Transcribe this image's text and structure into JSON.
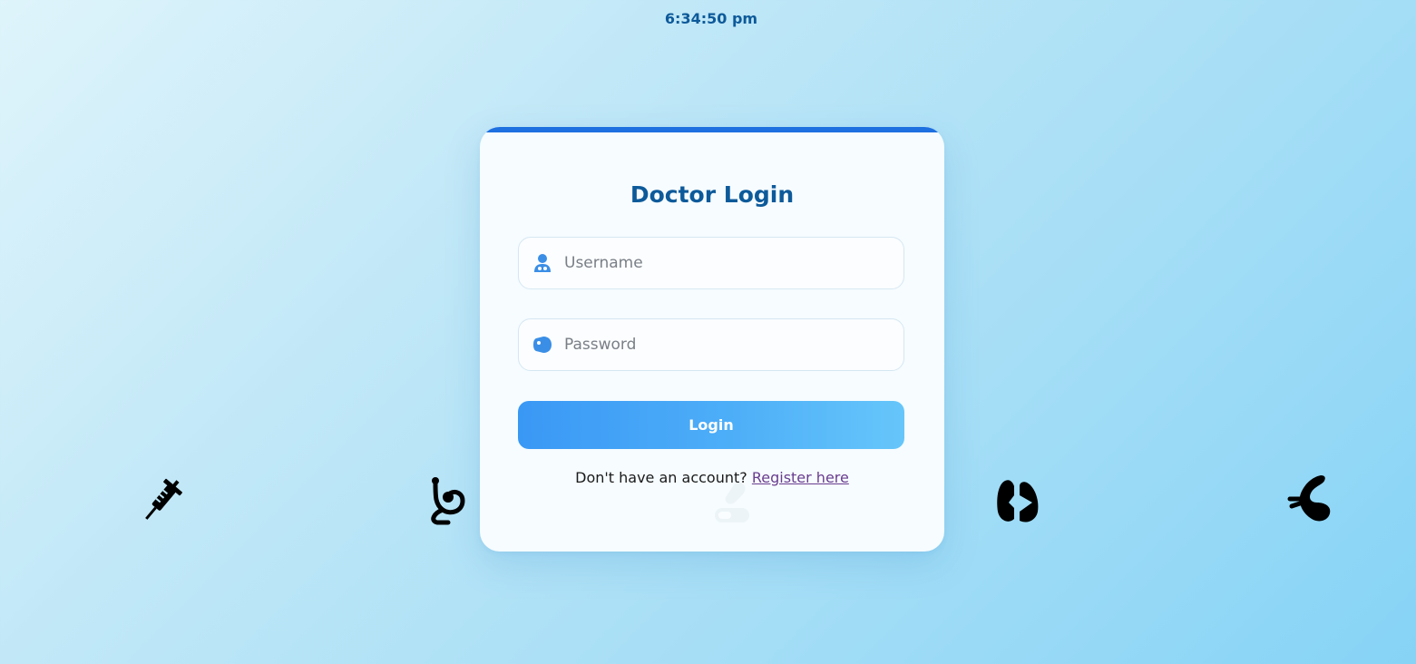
{
  "clock": {
    "time": "6:34:50 pm"
  },
  "background_icons": [
    "syringe-icon",
    "stethoscope-icon",
    "pills-icon",
    "lungs-icon",
    "bacteria-icon"
  ],
  "login": {
    "title": "Doctor Login",
    "username": {
      "placeholder": "Username",
      "value": "",
      "icon": "user-doctor-icon"
    },
    "password": {
      "placeholder": "Password",
      "value": "",
      "icon": "tag-icon"
    },
    "submit_label": "Login",
    "register_prompt": "Don't have an account?",
    "register_link": "Register here"
  },
  "colors": {
    "accent": "#1e6fe0",
    "title": "#0d5a9a",
    "button_start": "#3a98f5",
    "button_end": "#66c6fa",
    "link": "#6a3d8f"
  }
}
